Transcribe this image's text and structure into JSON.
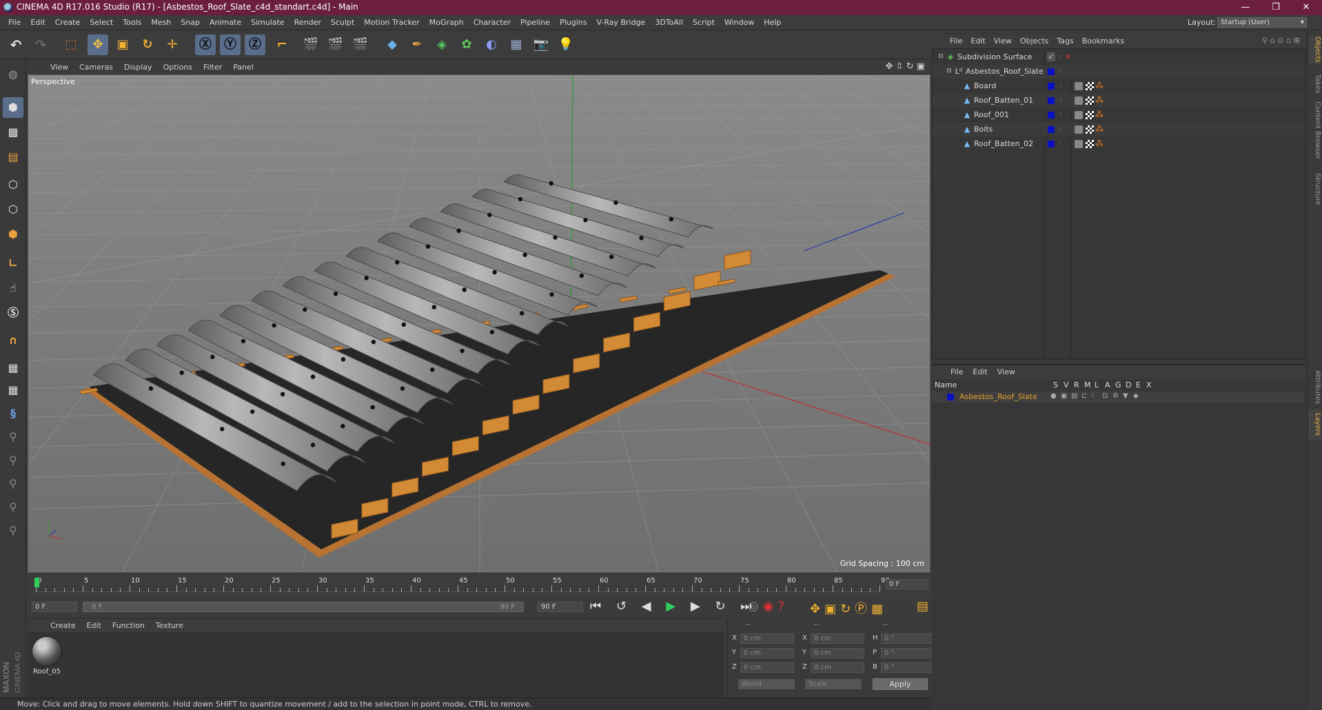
{
  "window": {
    "title": "CINEMA 4D R17.016 Studio (R17) - [Asbestos_Roof_Slate_c4d_standart.c4d] - Main",
    "minimize": "—",
    "maximize": "❐",
    "close": "✕"
  },
  "menubar": {
    "items": [
      "File",
      "Edit",
      "Create",
      "Select",
      "Tools",
      "Mesh",
      "Snap",
      "Animate",
      "Simulate",
      "Render",
      "Sculpt",
      "Motion Tracker",
      "MoGraph",
      "Character",
      "Pipeline",
      "Plugins",
      "V-Ray Bridge",
      "3DToAll",
      "Script",
      "Window",
      "Help"
    ],
    "layout_label": "Layout:",
    "layout_value": "Startup (User)"
  },
  "viewport": {
    "menu": [
      "View",
      "Cameras",
      "Display",
      "Options",
      "Filter",
      "Panel"
    ],
    "label": "Perspective",
    "grid_spacing": "Grid Spacing : 100 cm"
  },
  "timeline": {
    "ticks": [
      "0",
      "5",
      "10",
      "15",
      "20",
      "25",
      "30",
      "35",
      "40",
      "45",
      "50",
      "55",
      "60",
      "65",
      "70",
      "75",
      "80",
      "85",
      "90"
    ],
    "current_frame": "0 F",
    "start_field": "0 F",
    "range_start": "0 F",
    "range_end": "90 F",
    "end_field": "90 F"
  },
  "material_manager": {
    "menu": [
      "Create",
      "Edit",
      "Function",
      "Texture"
    ],
    "materials": [
      {
        "name": "Roof_05"
      }
    ]
  },
  "coordinates": {
    "headers": [
      "--",
      "--",
      "--"
    ],
    "rows": [
      {
        "a": "X",
        "av": "0 cm",
        "b": "X",
        "bv": "0 cm",
        "c": "H",
        "cv": "0 °"
      },
      {
        "a": "Y",
        "av": "0 cm",
        "b": "Y",
        "bv": "0 cm",
        "c": "P",
        "cv": "0 °"
      },
      {
        "a": "Z",
        "av": "0 cm",
        "b": "Z",
        "bv": "0 cm",
        "c": "B",
        "cv": "0 °"
      }
    ],
    "space": "World",
    "mode": "Scale",
    "apply": "Apply"
  },
  "status": "Move: Click and drag to move elements. Hold down SHIFT to quantize movement / add to the selection in point mode, CTRL to remove.",
  "object_manager": {
    "menu": [
      "File",
      "Edit",
      "View",
      "Objects",
      "Tags",
      "Bookmarks"
    ],
    "objects": [
      {
        "name": "Subdivision Surface",
        "indent": 0
      },
      {
        "name": "Asbestos_Roof_Slate",
        "indent": 1
      },
      {
        "name": "Board",
        "indent": 2
      },
      {
        "name": "Roof_Batten_01",
        "indent": 2
      },
      {
        "name": "Roof_001",
        "indent": 2
      },
      {
        "name": "Bolts",
        "indent": 2
      },
      {
        "name": "Roof_Batten_02",
        "indent": 2
      }
    ]
  },
  "layer_manager": {
    "menu": [
      "File",
      "Edit",
      "View"
    ],
    "columns": [
      "Name",
      "S",
      "V",
      "R",
      "M",
      "L",
      "A",
      "G",
      "D",
      "E",
      "X"
    ],
    "layers": [
      {
        "name": "Asbestos_Roof_Slate",
        "color": "#0a11c2"
      }
    ]
  },
  "right_tabs": [
    "Objects",
    "Takes",
    "Content Browser",
    "Structure",
    "Attributes",
    "Layers"
  ],
  "maxon_logo": "MAXON CINEMA 4D",
  "colors": {
    "titlebar": "#6b1f3c",
    "selected_tool": "#5a6e8c",
    "layer_name": "#e6a028",
    "layer_swatch": "#0a11c2"
  }
}
